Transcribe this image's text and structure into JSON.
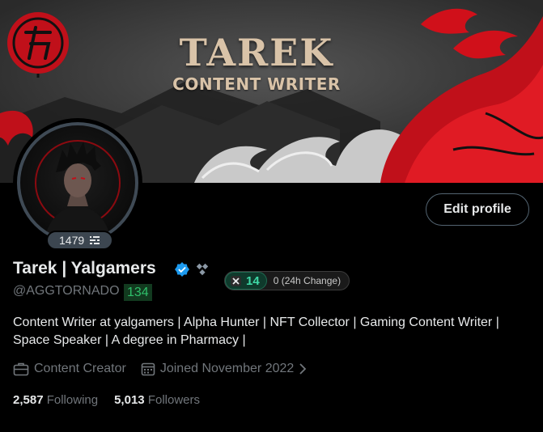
{
  "banner": {
    "title": "TAREK",
    "subtitle": "CONTENT WRITER"
  },
  "profile": {
    "badge_count": "1479",
    "name": "Tarek | Yalgamers",
    "handle": "@AGGTORNADO",
    "handle_score": "134",
    "score": "14",
    "score_change": "0 (24h Change)",
    "edit_label": "Edit profile",
    "bio": "Content Writer at yalgamers | Alpha Hunter | NFT Collector | Gaming Content Writer | Space Speaker | A degree in Pharmacy |",
    "category": "Content Creator",
    "joined": "Joined November 2022",
    "following_count": "2,587",
    "following_label": "Following",
    "followers_count": "5,013",
    "followers_label": "Followers"
  },
  "colors": {
    "background": "#000000",
    "text_primary": "#e7e9ea",
    "text_secondary": "#71767b",
    "verified_blue": "#1d9bf0",
    "accent_red": "#d0101a",
    "score_green": "#3fd9a7"
  },
  "icons": [
    "verified-badge-icon",
    "affiliate-diamond-icon",
    "briefcase-icon",
    "calendar-icon",
    "chevron-right-icon",
    "list-icon",
    "x-logo-icon"
  ]
}
